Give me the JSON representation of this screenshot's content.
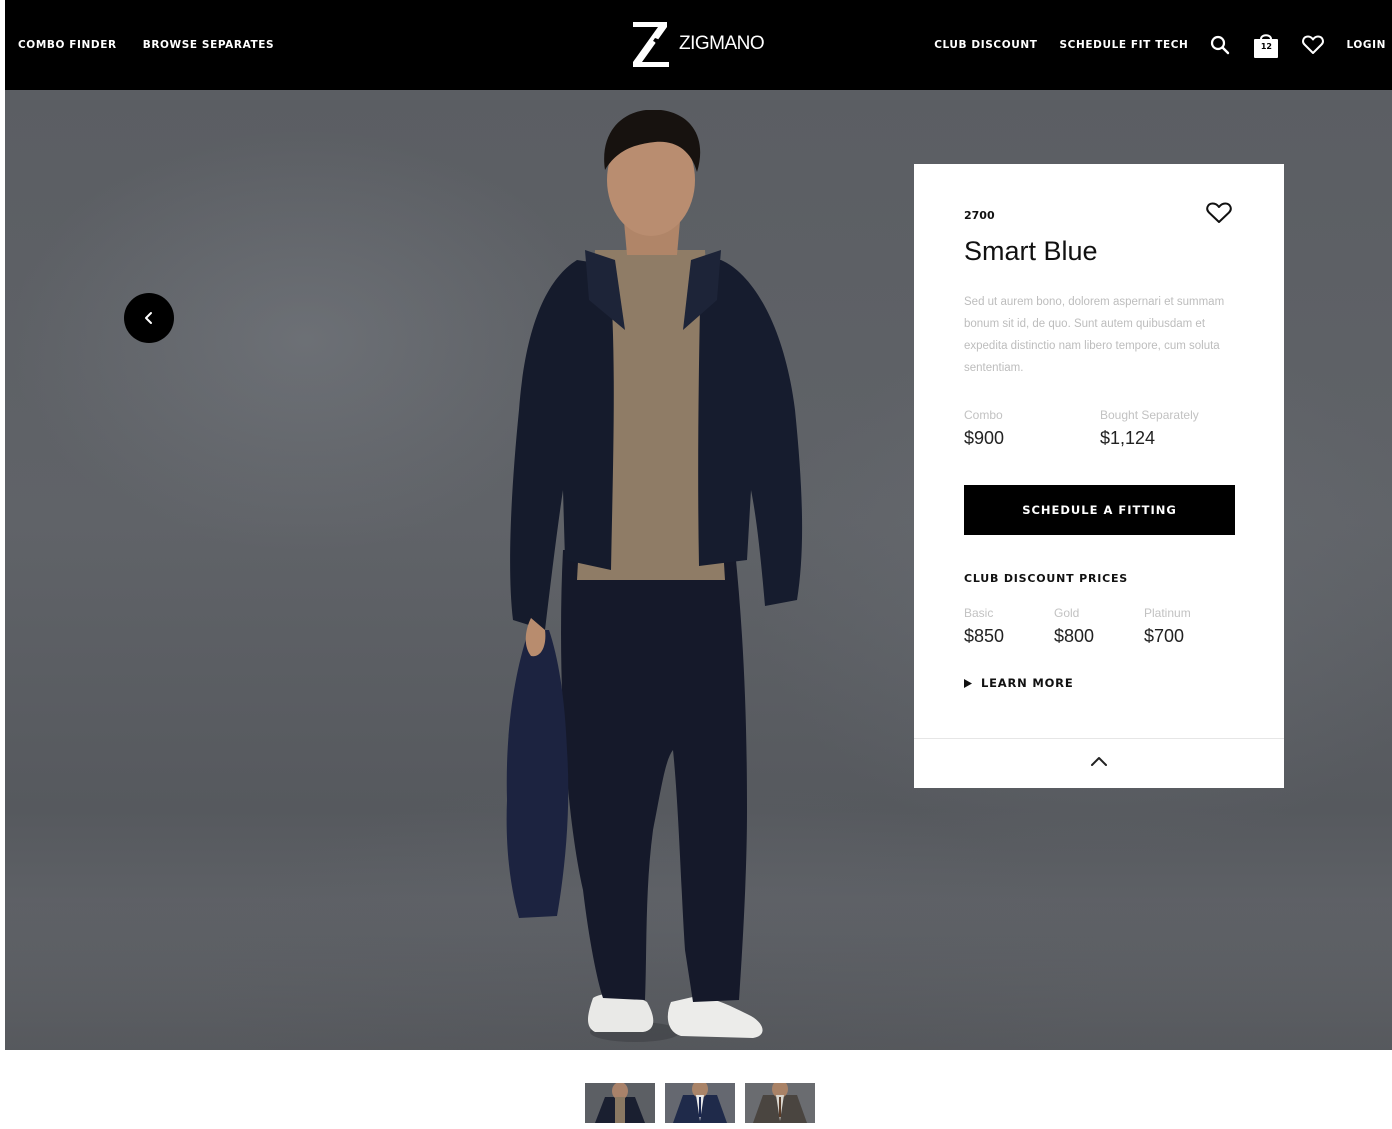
{
  "header": {
    "nav_left": [
      "COMBO FINDER",
      "BROWSE SEPARATES"
    ],
    "logo_text": "ZIGMANO",
    "nav_right": [
      "CLUB DISCOUNT",
      "SCHEDULE FIT TECH"
    ],
    "bag_count": "12",
    "login_label": "LOGIN"
  },
  "hero": {
    "prev_icon": "chevron-left-icon"
  },
  "product": {
    "sku": "2700",
    "name": "Smart Blue",
    "description": "Sed ut aurem bono, dolorem aspernari et summam bonum sit id, de quo. Sunt autem quibusdam et expedita distinctio nam libero tempore, cum soluta sententiam.",
    "combo_label": "Combo",
    "combo_price": "$900",
    "separate_label": "Bought Separately",
    "separate_price": "$1,124",
    "cta_label": "SCHEDULE A FITTING",
    "club_heading": "CLUB DISCOUNT PRICES",
    "tiers": [
      {
        "label": "Basic",
        "price": "$850"
      },
      {
        "label": "Gold",
        "price": "$800"
      },
      {
        "label": "Platinum",
        "price": "$700"
      }
    ],
    "learn_more": "LEARN MORE"
  },
  "colors": {
    "header_bg": "#000000",
    "accent": "#000000",
    "card_bg": "#ffffff"
  }
}
